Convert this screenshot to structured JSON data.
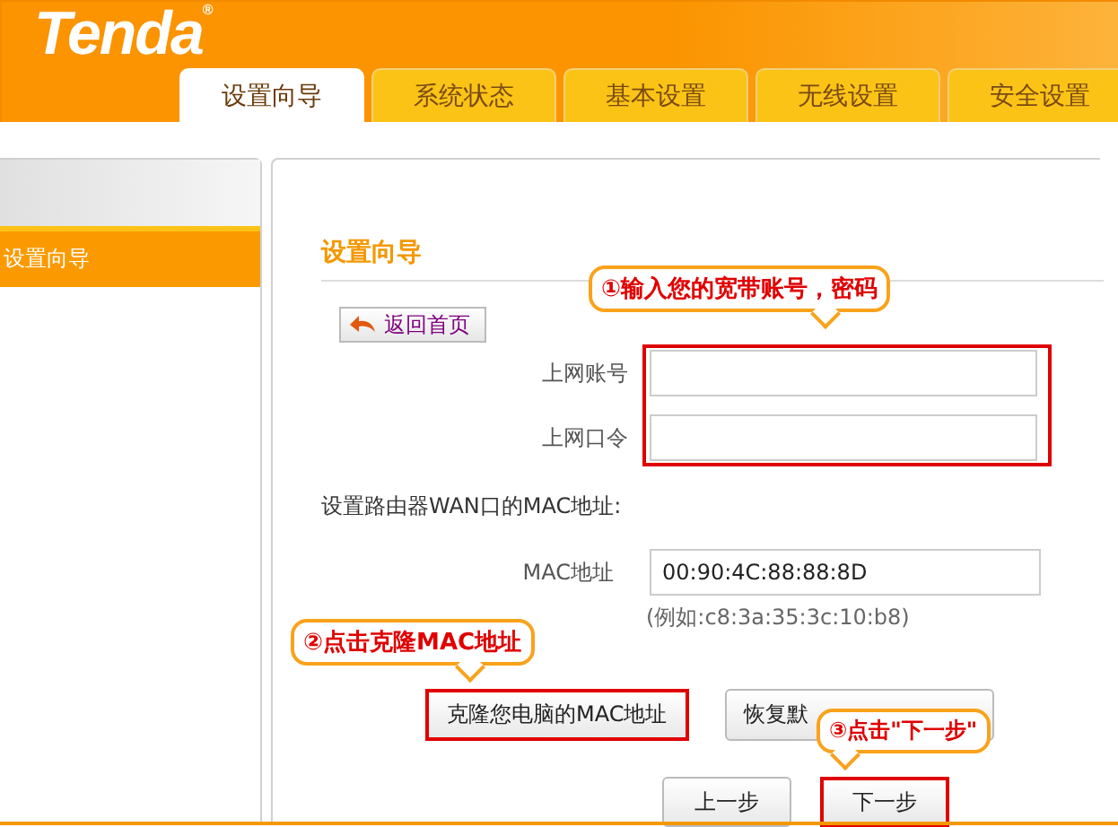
{
  "logo": "Tenda",
  "logo_mark": "®",
  "tabs": [
    {
      "label": "设置向导",
      "selected": true
    },
    {
      "label": "系统状态",
      "selected": false
    },
    {
      "label": "基本设置",
      "selected": false
    },
    {
      "label": "无线设置",
      "selected": false
    },
    {
      "label": "安全设置",
      "selected": false
    }
  ],
  "sidebar": {
    "items": [
      {
        "label": "设置向导",
        "selected": true
      }
    ]
  },
  "panel": {
    "title": "设置向导",
    "back_button": "返回首页",
    "fields": [
      {
        "label": "上网账号"
      },
      {
        "label": "上网口令"
      }
    ],
    "mac_heading": "设置路由器WAN口的MAC地址:",
    "mac_label": "MAC地址",
    "mac_value": "00:90:4C:88:88:8D",
    "mac_hint": "(例如:c8:3a:35:3c:10:b8)",
    "mac_buttons": [
      "克隆您电脑的MAC地址",
      "恢复默"
    ],
    "nav_buttons": [
      "上一步",
      "下一步"
    ]
  },
  "callouts": [
    "①输入您的宽带账号，密码",
    "②点击克隆MAC地址",
    "③点击\"下一步\""
  ]
}
